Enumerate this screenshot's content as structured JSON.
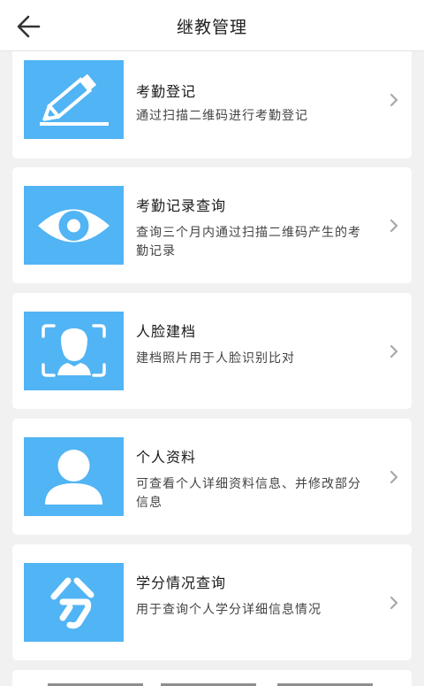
{
  "header": {
    "title": "继教管理"
  },
  "colors": {
    "accent": "#51b4f4",
    "chevron": "#a8a8a8"
  },
  "items": [
    {
      "icon": "pencil-icon",
      "title": "考勤登记",
      "desc": "通过扫描二维码进行考勤登记"
    },
    {
      "icon": "eye-icon",
      "title": "考勤记录查询",
      "desc": "查询三个月内通过扫描二维码产生的考勤记录"
    },
    {
      "icon": "face-scan-icon",
      "title": "人脸建档",
      "desc": "建档照片用于人脸识别比对"
    },
    {
      "icon": "person-icon",
      "title": "个人资料",
      "desc": "可查看个人详细资料信息、并修改部分信息"
    },
    {
      "icon": "credit-icon",
      "title": "学分情况查询",
      "desc": "用于查询个人学分详细信息情况"
    }
  ]
}
